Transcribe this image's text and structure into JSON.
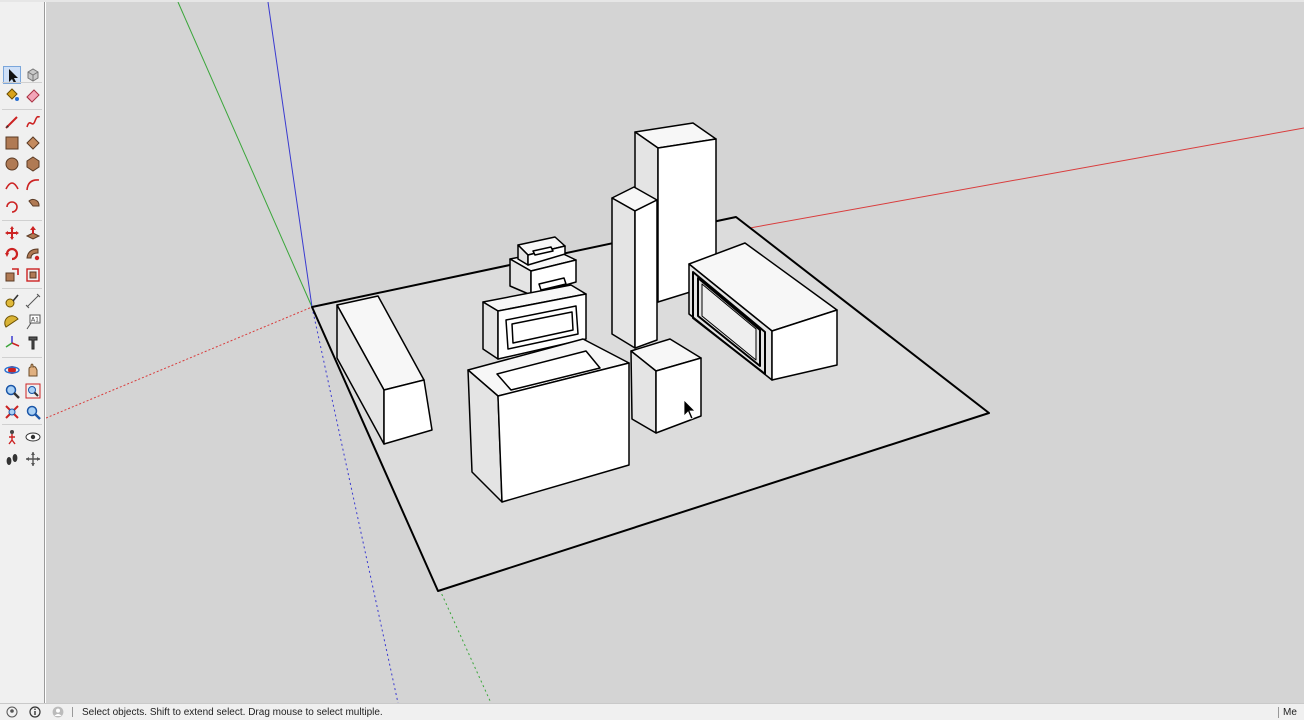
{
  "toolbar": {
    "tools": [
      {
        "name": "select",
        "icon": "select-arrow-icon",
        "active": true
      },
      {
        "name": "make-component",
        "icon": "component-icon"
      },
      {
        "name": "paint-bucket",
        "icon": "paint-bucket-icon"
      },
      {
        "name": "eraser",
        "icon": "eraser-icon"
      },
      {
        "name": "line",
        "icon": "pencil-line-icon"
      },
      {
        "name": "freehand",
        "icon": "freehand-icon"
      },
      {
        "name": "rectangle",
        "icon": "rectangle-icon"
      },
      {
        "name": "rotated-rectangle",
        "icon": "rotated-rectangle-icon"
      },
      {
        "name": "circle",
        "icon": "circle-icon"
      },
      {
        "name": "polygon",
        "icon": "polygon-icon"
      },
      {
        "name": "arc",
        "icon": "arc-icon"
      },
      {
        "name": "two-point-arc",
        "icon": "two-point-arc-icon"
      },
      {
        "name": "three-point-arc",
        "icon": "three-point-arc-icon"
      },
      {
        "name": "pie",
        "icon": "pie-icon"
      },
      {
        "name": "move",
        "icon": "move-icon"
      },
      {
        "name": "push-pull",
        "icon": "push-pull-icon"
      },
      {
        "name": "rotate",
        "icon": "rotate-icon"
      },
      {
        "name": "follow-me",
        "icon": "follow-me-icon"
      },
      {
        "name": "scale",
        "icon": "scale-icon"
      },
      {
        "name": "offset",
        "icon": "offset-icon"
      },
      {
        "name": "tape-measure",
        "icon": "tape-measure-icon"
      },
      {
        "name": "dimension",
        "icon": "dimension-icon"
      },
      {
        "name": "protractor",
        "icon": "protractor-icon"
      },
      {
        "name": "text",
        "icon": "text-icon"
      },
      {
        "name": "axes",
        "icon": "axes-icon"
      },
      {
        "name": "3d-text",
        "icon": "3d-text-icon"
      },
      {
        "name": "orbit",
        "icon": "orbit-icon"
      },
      {
        "name": "pan",
        "icon": "pan-hand-icon"
      },
      {
        "name": "zoom",
        "icon": "zoom-icon"
      },
      {
        "name": "zoom-window",
        "icon": "zoom-window-icon"
      },
      {
        "name": "zoom-extents",
        "icon": "zoom-extents-icon"
      },
      {
        "name": "previous-view",
        "icon": "previous-view-icon"
      },
      {
        "name": "position-camera",
        "icon": "position-camera-icon"
      },
      {
        "name": "look-around",
        "icon": "look-around-icon"
      },
      {
        "name": "walk",
        "icon": "walk-icon"
      },
      {
        "name": "section-plane",
        "icon": "section-plane-icon"
      }
    ]
  },
  "viewport": {
    "background": "#d4d4d4",
    "axis_colors": {
      "red": "#d93c3c",
      "green": "#3aa63a",
      "blue": "#3a3ad0"
    }
  },
  "statusbar": {
    "icons": [
      "geo-location-icon",
      "credits-icon",
      "user-account-icon"
    ],
    "text": "Select objects. Shift to extend select. Drag mouse to select multiple.",
    "right_text": "Me"
  }
}
